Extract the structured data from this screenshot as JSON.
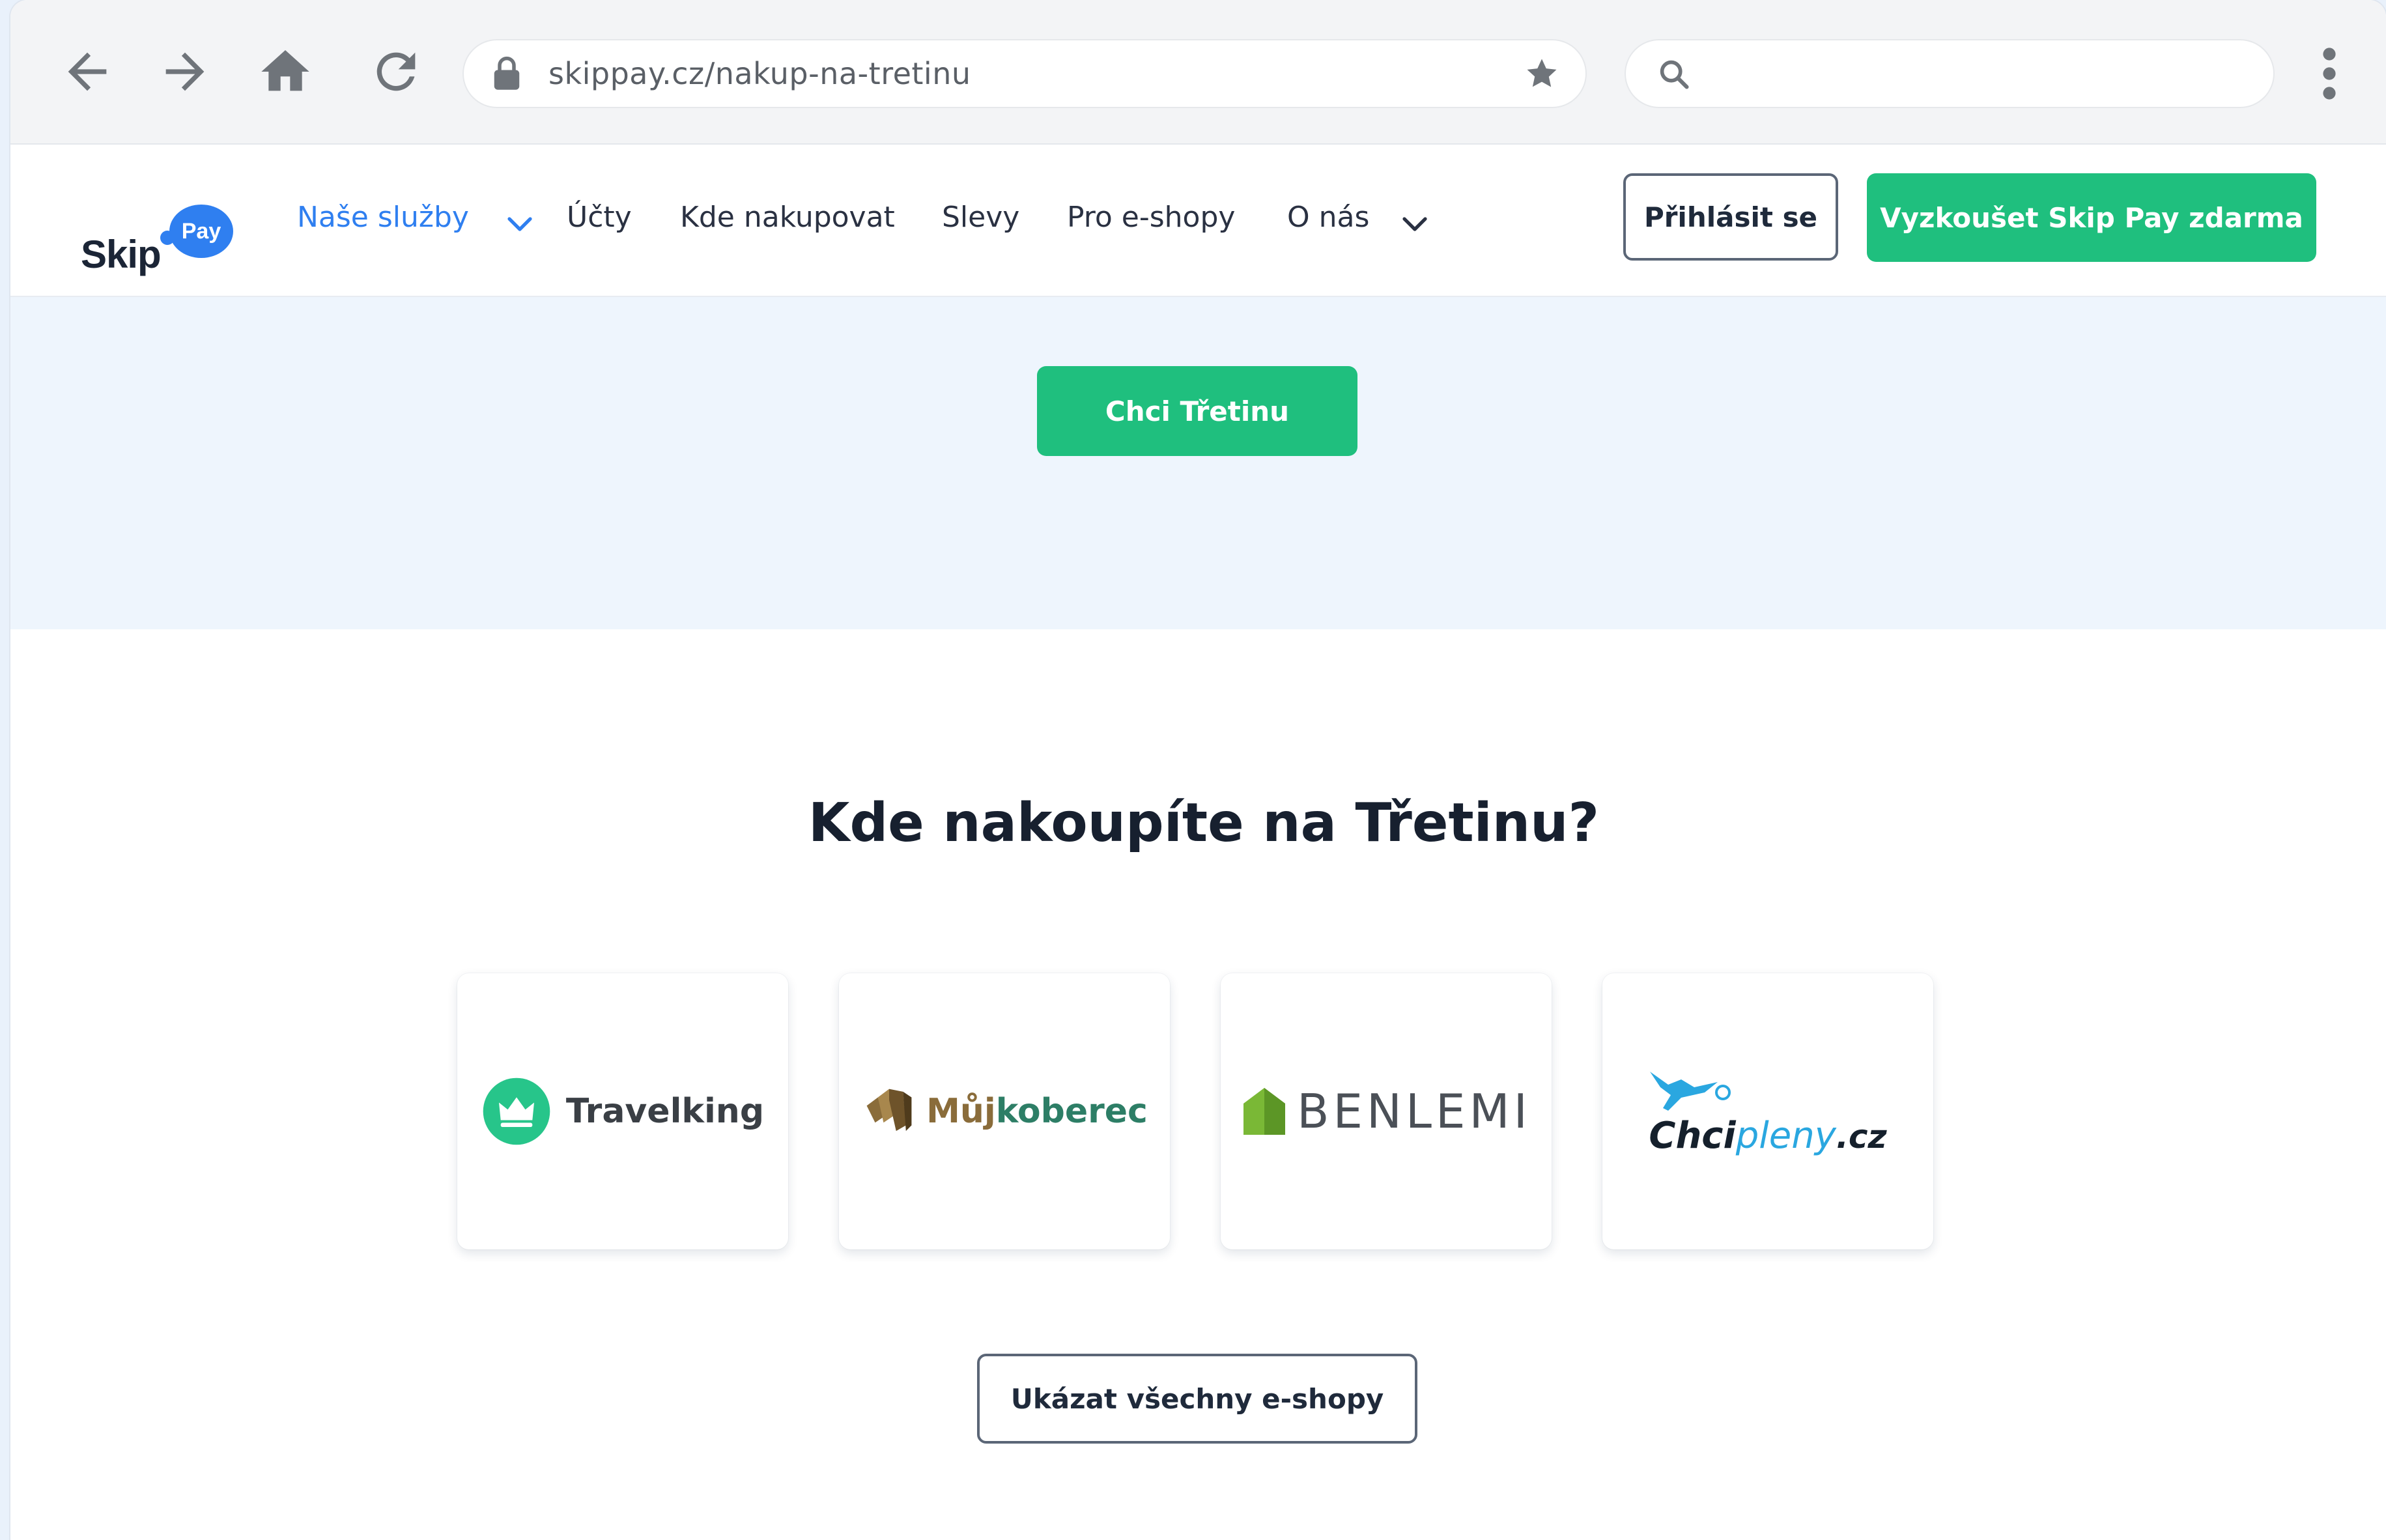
{
  "browser": {
    "url": "skippay.cz/nakup-na-tretinu",
    "search_placeholder": ""
  },
  "header": {
    "logo_text": "Skip",
    "logo_badge": "Pay",
    "menu": [
      {
        "label": "Naše služby"
      },
      {
        "label": "Účty"
      },
      {
        "label": "Kde nakupovat"
      },
      {
        "label": "Slevy"
      },
      {
        "label": "Pro e-shopy"
      },
      {
        "label": "O nás"
      }
    ],
    "login_label": "Přihlásit se",
    "try_label": "Vyzkoušet Skip Pay zdarma"
  },
  "hero": {
    "cta_label": "Chci Třetinu"
  },
  "shops": {
    "title": "Kde nakoupíte na Třetinu?",
    "items": [
      {
        "name": "Travelking",
        "logo_icon": "crown-icon",
        "color": "#27c58a"
      },
      {
        "name_part1": "Můj",
        "name_part2": "koberec",
        "logo_icon": "carpet-roll-icon",
        "color": "#8a6c3a"
      },
      {
        "name": "BENLEMI",
        "logo_icon": "house-icon",
        "color": "#7ab836"
      },
      {
        "name_part1": "Chci",
        "name_part2": "pleny",
        "name_part3": ".cz",
        "logo_icon": "stork-icon",
        "color": "#2aa7e0"
      }
    ],
    "all_label": "Ukázat všechny e-shopy"
  },
  "colors": {
    "accent_green": "#1fbf7e",
    "brand_blue": "#2f7ff0",
    "hero_bg": "#eef5fd"
  }
}
